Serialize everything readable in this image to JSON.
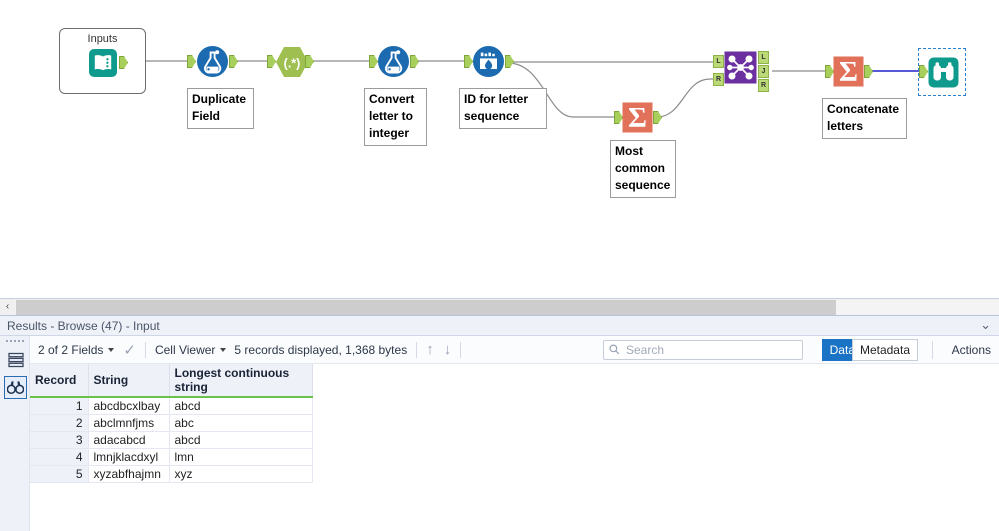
{
  "canvas": {
    "container": {
      "title": "Inputs"
    },
    "tools": [
      {
        "id": "text-input",
        "icon": "book-icon",
        "label": ""
      },
      {
        "id": "formula-1",
        "icon": "flask-icon",
        "label": "Duplicate\nField"
      },
      {
        "id": "regex",
        "icon": "regex-hexagon-icon",
        "label": ""
      },
      {
        "id": "formula-2",
        "icon": "flask-icon",
        "label": "Convert\nletter to\ninteger"
      },
      {
        "id": "multi-row-formula",
        "icon": "multi-row-formula-icon",
        "label": "ID for letter\nsequence"
      },
      {
        "id": "summarize-1",
        "icon": "sigma-icon",
        "label": "Most\ncommon\nsequence"
      },
      {
        "id": "join",
        "icon": "join-icon",
        "label": ""
      },
      {
        "id": "summarize-2",
        "icon": "sigma-icon",
        "label": "Concatenate\nletters"
      },
      {
        "id": "browse",
        "icon": "binoculars-icon",
        "label": ""
      }
    ],
    "join_anchors": {
      "in_left": "L",
      "in_right": "R",
      "out_left": "L",
      "out_join": "J",
      "out_right": "R"
    },
    "colors": {
      "formula_blue": "#1c6bb0",
      "regex_green": "#9fbf50",
      "summarize_salmon": "#e2715a",
      "join_purple": "#6b2fa0",
      "browse_teal": "#0e9b8e",
      "anchor_green": "#a8cf5c",
      "wire_gray": "#8c8c8c",
      "wire_selected_blue": "#2222cc",
      "selection_dash": "#2b7fd4"
    }
  },
  "canvas_scroll": {
    "left_arrow": "‹"
  },
  "results": {
    "header_title": "Results - Browse (47) - Input",
    "collapse_icon": "⌄",
    "rail": [
      {
        "name": "grid-view-icon",
        "active": false
      },
      {
        "name": "browse-binoculars-icon",
        "active": true
      }
    ],
    "toolbar": {
      "fields_label": "2 of 2 Fields",
      "check_icon": "✓",
      "cell_viewer_label": "Cell Viewer",
      "records_label": "5 records displayed, 1,368 bytes",
      "up_arrow": "↑",
      "down_arrow": "↓",
      "search_placeholder": "Search",
      "data_tab": "Data",
      "metadata_tab": "Metadata",
      "actions_label": "Actions"
    },
    "table": {
      "columns": [
        "Record",
        "String",
        "Longest continuous string"
      ],
      "rows": [
        {
          "record": "1",
          "string": "abcdbcxlbay",
          "longest": "abcd"
        },
        {
          "record": "2",
          "string": "abclmnfjms",
          "longest": "abc"
        },
        {
          "record": "3",
          "string": "adacabcd",
          "longest": "abcd"
        },
        {
          "record": "4",
          "string": "lmnjklacdxyl",
          "longest": "lmn"
        },
        {
          "record": "5",
          "string": "xyzabfhajmn",
          "longest": "xyz"
        }
      ]
    }
  }
}
